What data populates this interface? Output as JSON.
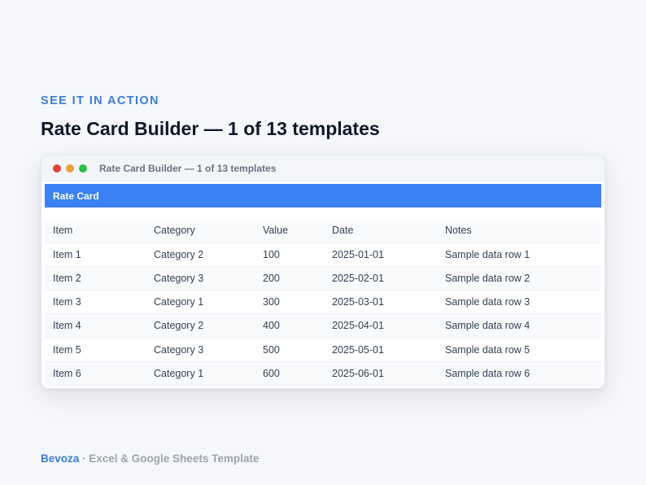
{
  "eyebrow": "SEE IT IN ACTION",
  "headline": "Rate Card Builder — 1 of 13 templates",
  "window": {
    "title": "Rate Card Builder — 1 of 13 templates",
    "sheet_header": "Rate Card"
  },
  "table": {
    "columns": [
      "Item",
      "Category",
      "Value",
      "Date",
      "Notes"
    ],
    "rows": [
      [
        "Item 1",
        "Category 2",
        "100",
        "2025-01-01",
        "Sample data row 1"
      ],
      [
        "Item 2",
        "Category 3",
        "200",
        "2025-02-01",
        "Sample data row 2"
      ],
      [
        "Item 3",
        "Category 1",
        "300",
        "2025-03-01",
        "Sample data row 3"
      ],
      [
        "Item 4",
        "Category 2",
        "400",
        "2025-04-01",
        "Sample data row 4"
      ],
      [
        "Item 5",
        "Category 3",
        "500",
        "2025-05-01",
        "Sample data row 5"
      ],
      [
        "Item 6",
        "Category 1",
        "600",
        "2025-06-01",
        "Sample data row 6"
      ]
    ]
  },
  "footer": {
    "brand": "Bevoza",
    "separator": " · ",
    "tagline": "Excel & Google Sheets Template"
  },
  "colors": {
    "accent": "#3b7dd8",
    "sheet_header": "#3b82f6",
    "close_dot": "#e0443e",
    "minimize_dot": "#e8a23a",
    "maximize_dot": "#27c246"
  }
}
